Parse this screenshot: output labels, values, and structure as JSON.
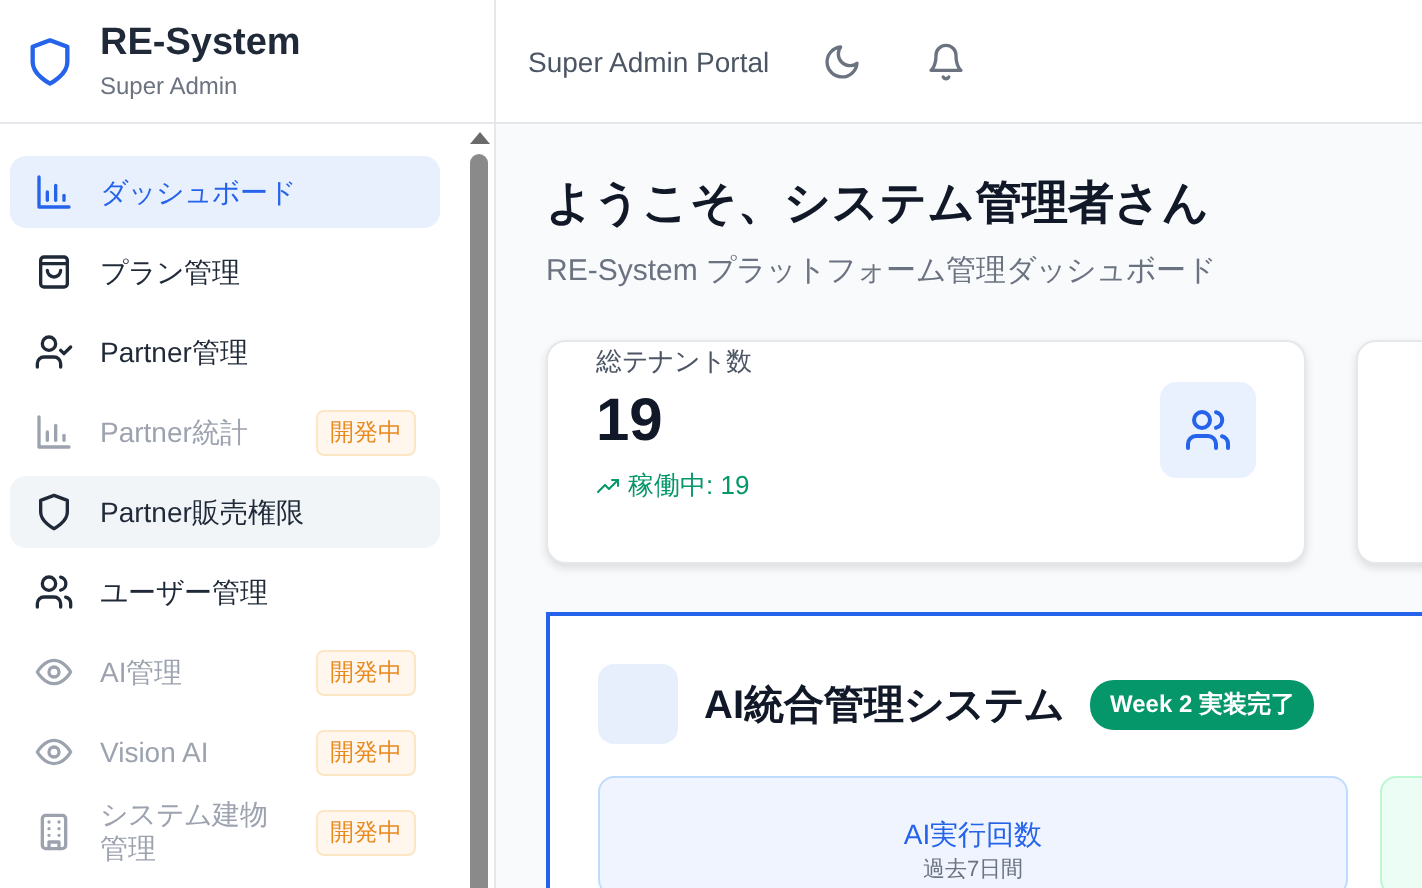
{
  "brand": {
    "title": "RE-System",
    "subtitle": "Super Admin"
  },
  "sidebar": {
    "items": [
      {
        "label": "ダッシュボード",
        "selected": true,
        "hovered": false,
        "disabled": false
      },
      {
        "label": "プラン管理",
        "selected": false,
        "hovered": false,
        "disabled": false
      },
      {
        "label": "Partner管理",
        "selected": false,
        "hovered": false,
        "disabled": false
      },
      {
        "label": "Partner統計",
        "selected": false,
        "hovered": false,
        "disabled": true,
        "badge": "開発中"
      },
      {
        "label": "Partner販売権限",
        "selected": false,
        "hovered": true,
        "disabled": false
      },
      {
        "label": "ユーザー管理",
        "selected": false,
        "hovered": false,
        "disabled": false
      },
      {
        "label": "AI管理",
        "selected": false,
        "hovered": false,
        "disabled": true,
        "badge": "開発中"
      },
      {
        "label": "Vision AI",
        "selected": false,
        "hovered": false,
        "disabled": true,
        "badge": "開発中"
      },
      {
        "label": "システム建物管理",
        "selected": false,
        "hovered": false,
        "disabled": true,
        "badge": "開発中"
      }
    ]
  },
  "header": {
    "title": "Super Admin Portal"
  },
  "page": {
    "title": "ようこそ、システム管理者さん",
    "subtitle": "RE-System プラットフォーム管理ダッシュボード"
  },
  "stats": [
    {
      "label": "総テナント数",
      "value": "19",
      "trend": "稼働中: 19"
    }
  ],
  "ai_panel": {
    "title": "AI統合管理システム",
    "badge": "Week 2 実装完了",
    "metrics": [
      {
        "title": "AI実行回数",
        "subtitle": "過去7日間"
      }
    ]
  }
}
